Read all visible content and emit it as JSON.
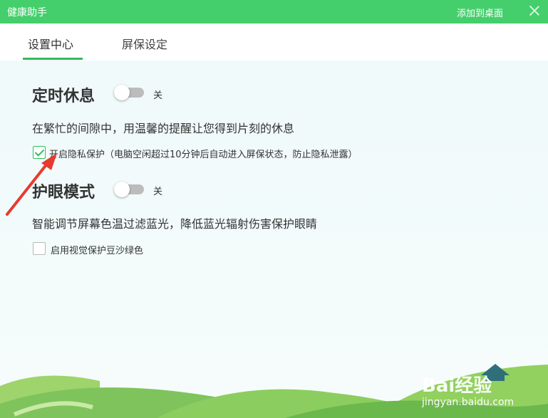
{
  "window": {
    "title": "健康助手",
    "add_to_desktop": "添加到桌面",
    "close_icon": "close-icon"
  },
  "tabs": [
    {
      "label": "设置中心",
      "active": true
    },
    {
      "label": "屏保设定",
      "active": false
    }
  ],
  "sections": {
    "timed_rest": {
      "title": "定时休息",
      "toggle_state": "关",
      "description": "在繁忙的间隙中，用温馨的提醒让您得到片刻的休息",
      "checkbox_label": "开启隐私保护（电脑空闲超过10分钟后自动进入屏保状态，防止隐私泄露）",
      "checkbox_checked": true
    },
    "eye_care": {
      "title": "护眼模式",
      "toggle_state": "关",
      "description": "智能调节屏幕色温过滤蓝光，降低蓝光辐射伤害保护眼睛",
      "checkbox_label": "启用视觉保护豆沙绿色",
      "checkbox_checked": false
    }
  },
  "watermark": {
    "brand": "Bai经验",
    "url": "jingyan.baidu.com"
  },
  "colors": {
    "accent": "#44cf6c",
    "annotation_arrow": "#e83a2f"
  }
}
